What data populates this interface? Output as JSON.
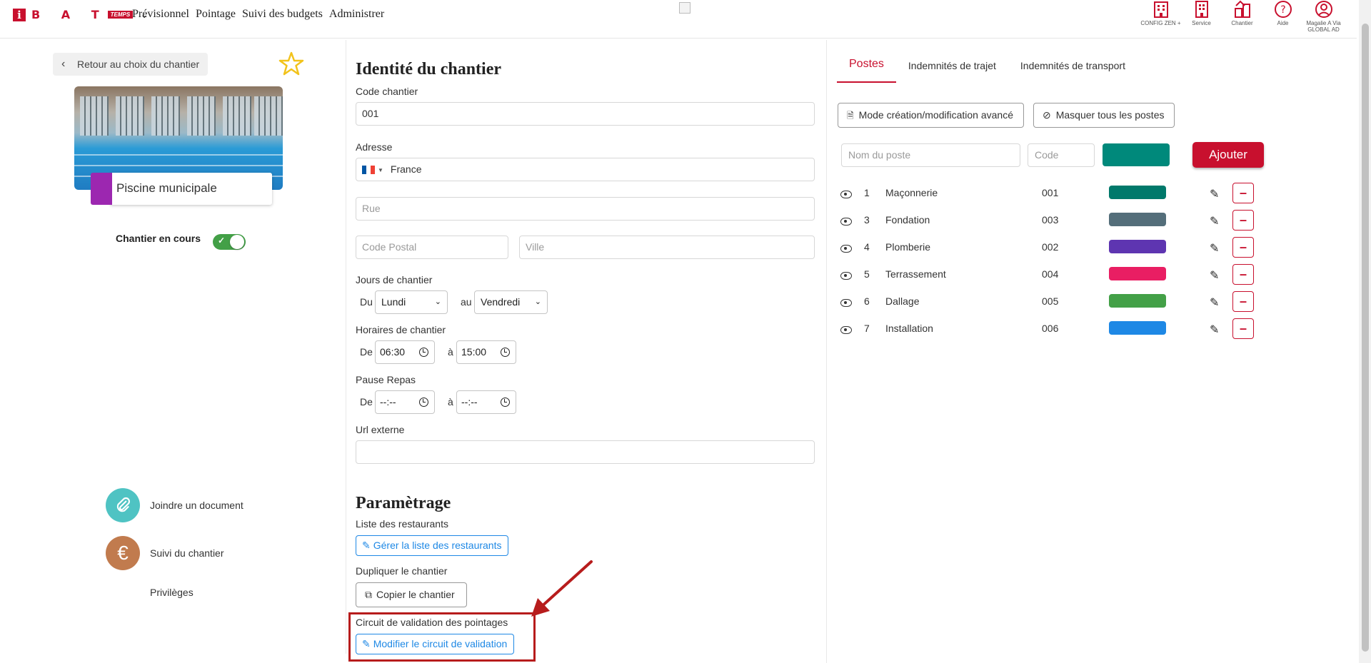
{
  "header": {
    "logo": {
      "letter": "i",
      "brand": "B A T",
      "sub": "TEMPS"
    },
    "nav": [
      "Prévisionnel",
      "Pointage",
      "Suivi des budgets",
      "Administrer"
    ],
    "icons": [
      {
        "icon": "building-icon",
        "label": "CONFIG ZEN +"
      },
      {
        "icon": "office-icon",
        "label": "Service"
      },
      {
        "icon": "site-icon",
        "label": "Chantier"
      },
      {
        "icon": "help-icon",
        "label": "Aide"
      },
      {
        "icon": "user-icon",
        "label": "Magalie A Via GLOBAL AD"
      }
    ]
  },
  "left": {
    "back_label": "Retour au choix du chantier",
    "site_name": "Piscine municipale",
    "site_color": "#9c27b0",
    "status_label": "Chantier en cours",
    "status_on": true,
    "actions": [
      {
        "label": "Joindre un document",
        "icon": "paperclip-icon",
        "color": "#4fc3c3"
      },
      {
        "label": "Suivi du chantier",
        "icon": "euro-icon",
        "color": "#c17b4e"
      }
    ],
    "privileges": "Privilèges"
  },
  "identity": {
    "title": "Identité du chantier",
    "code_label": "Code chantier",
    "code_value": "001",
    "address_label": "Adresse",
    "country": "France",
    "street_placeholder": "Rue",
    "zip_placeholder": "Code Postal",
    "city_placeholder": "Ville",
    "days_label": "Jours de chantier",
    "days_from_prefix": "Du",
    "days_from": "Lundi",
    "days_to_prefix": "au",
    "days_to": "Vendredi",
    "hours_label": "Horaires de chantier",
    "hours_from_prefix": "De",
    "hours_from": "06:30",
    "hours_to_prefix": "à",
    "hours_to": "15:00",
    "break_label": "Pause Repas",
    "break_from_prefix": "De",
    "break_from": "--:--",
    "break_to_prefix": "à",
    "break_to": "--:--",
    "url_label": "Url externe",
    "url_value": ""
  },
  "settings": {
    "title": "Paramètrage",
    "restaurants_label": "Liste des restaurants",
    "restaurants_button": "Gérer la liste des restaurants",
    "duplicate_label": "Dupliquer le chantier",
    "duplicate_button": "Copier le chantier",
    "validation_label": "Circuit de validation des pointages",
    "validation_button": "Modifier le circuit de validation"
  },
  "right": {
    "tabs": [
      "Postes",
      "Indemnités de trajet",
      "Indemnités de transport"
    ],
    "active_tab": "Postes",
    "advanced_button": "Mode création/modification avancé",
    "hide_button": "Masquer tous les postes",
    "new_name_placeholder": "Nom du poste",
    "new_code_placeholder": "Code",
    "new_color": "#00897b",
    "add_button": "Ajouter",
    "postes": [
      {
        "num": "1",
        "name": "Maçonnerie",
        "code": "001",
        "color": "#00796b"
      },
      {
        "num": "3",
        "name": "Fondation",
        "code": "003",
        "color": "#546e7a"
      },
      {
        "num": "4",
        "name": "Plomberie",
        "code": "002",
        "color": "#5e35b1"
      },
      {
        "num": "5",
        "name": "Terrassement",
        "code": "004",
        "color": "#e91e63"
      },
      {
        "num": "6",
        "name": "Dallage",
        "code": "005",
        "color": "#43a047"
      },
      {
        "num": "7",
        "name": "Installation",
        "code": "006",
        "color": "#1e88e5"
      }
    ]
  }
}
